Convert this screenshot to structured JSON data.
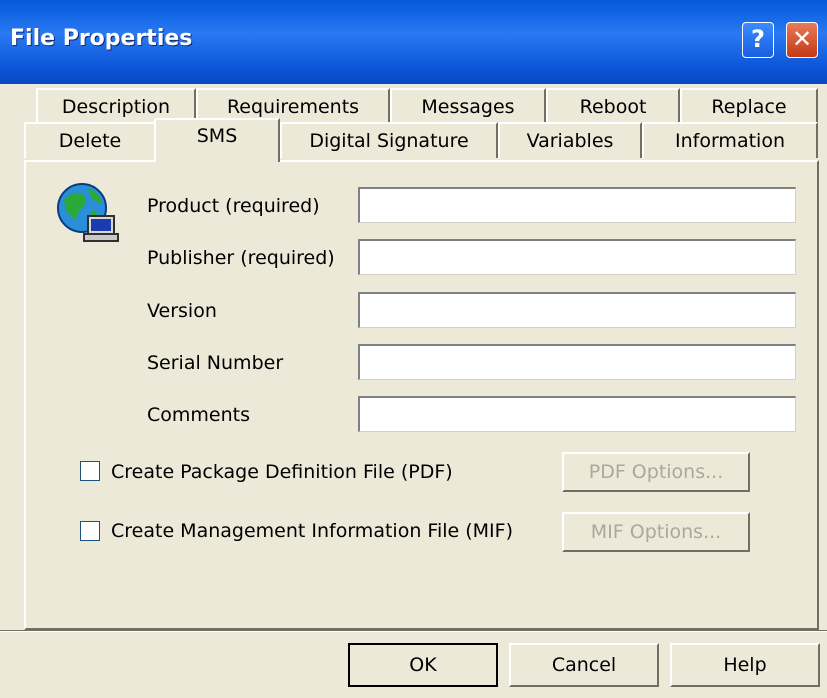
{
  "window": {
    "title": "File Properties",
    "help_label": "?",
    "close_label": "✕"
  },
  "tabs": {
    "row1": [
      "Description",
      "Requirements",
      "Messages",
      "Reboot",
      "Replace"
    ],
    "row2": [
      "Delete",
      "SMS",
      "Digital Signature",
      "Variables",
      "Information"
    ],
    "active": "SMS"
  },
  "form": {
    "icon": "globe-computer-icon",
    "fields": [
      {
        "label": "Product (required)",
        "value": ""
      },
      {
        "label": "Publisher (required)",
        "value": ""
      },
      {
        "label": "Version",
        "value": ""
      },
      {
        "label": "Serial Number",
        "value": ""
      },
      {
        "label": "Comments",
        "value": ""
      }
    ]
  },
  "options": {
    "pdf_checkbox_label": "Create Package Definition File (PDF)",
    "pdf_checked": false,
    "pdf_button": "PDF Options...",
    "mif_checkbox_label": "Create Management Information File (MIF)",
    "mif_checked": false,
    "mif_button": "MIF Options..."
  },
  "footer": {
    "ok_label": "OK",
    "cancel_label": "Cancel",
    "help_label": "Help"
  }
}
